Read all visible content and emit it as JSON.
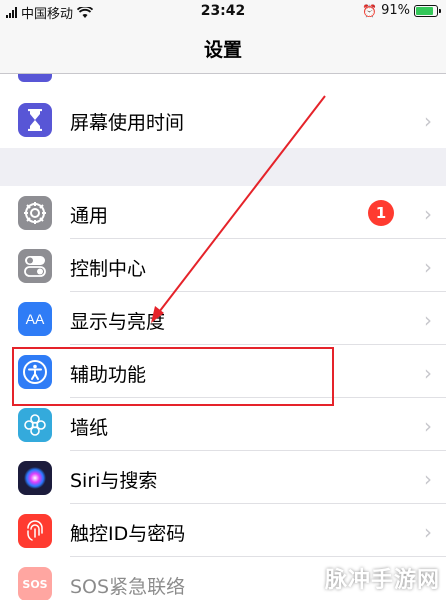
{
  "status_bar": {
    "carrier": "中国移动",
    "time": "23:42",
    "battery": "91%",
    "battery_level": 0.91
  },
  "nav": {
    "title": "设置"
  },
  "top_group": [
    {
      "label": "屏幕使用时间",
      "icon": "hourglass-icon",
      "color": "#5856d6"
    }
  ],
  "main_group": [
    {
      "label": "通用",
      "icon": "gear-icon",
      "color": "#8e8e93",
      "badge": "1"
    },
    {
      "label": "控制中心",
      "icon": "toggle-icon",
      "color": "#8e8e93"
    },
    {
      "label": "显示与亮度",
      "icon": "aa-icon",
      "icon_text": "AA",
      "color": "#2f7cf6"
    },
    {
      "label": "辅助功能",
      "icon": "accessibility-icon",
      "color": "#2f7cf6"
    },
    {
      "label": "墙纸",
      "icon": "flower-icon",
      "color": "#34aadc"
    },
    {
      "label": "Siri与搜索",
      "icon": "siri-icon",
      "color": "#1c1c3c"
    },
    {
      "label": "触控ID与密码",
      "icon": "fingerprint-icon",
      "color": "#ff3b30"
    },
    {
      "label": "SOS紧急联络",
      "icon": "sos-icon",
      "icon_text": "SOS",
      "color": "#ff3b30"
    }
  ],
  "annotation": {
    "highlight_color": "#e5232a"
  },
  "watermark": "脉冲手游网"
}
